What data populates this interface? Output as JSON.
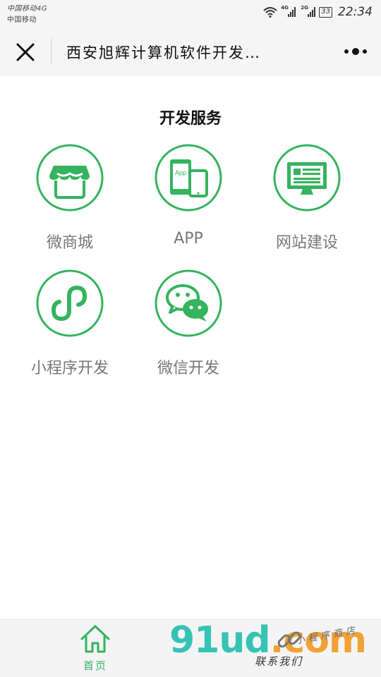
{
  "status_bar": {
    "carrier1": "中国移动4G",
    "carrier2": "中国移动",
    "net1": "4G",
    "net2": "2G",
    "battery": "33",
    "time": "22:34"
  },
  "navbar": {
    "title": "西安旭辉计算机软件开发…",
    "close_icon": "close-icon",
    "more_icon": "more-icon"
  },
  "section": {
    "title": "开发服务"
  },
  "services": [
    {
      "label": "微商城",
      "icon": "store-icon"
    },
    {
      "label": "APP",
      "icon": "mobile-app-icon",
      "icon_text": "App"
    },
    {
      "label": "网站建设",
      "icon": "monitor-icon"
    },
    {
      "label": "小程序开发",
      "icon": "mini-program-icon"
    },
    {
      "label": "微信开发",
      "icon": "wechat-icon"
    }
  ],
  "tabbar": {
    "home_label": "首页",
    "contact_label": "联系我们"
  },
  "watermark": {
    "text_green": "91ud",
    "text_orange": ".com",
    "subtitle": "小程序商店"
  },
  "colors": {
    "accent": "#35b35e",
    "label_gray": "#777777",
    "bar_bg": "#f5f5f5"
  }
}
